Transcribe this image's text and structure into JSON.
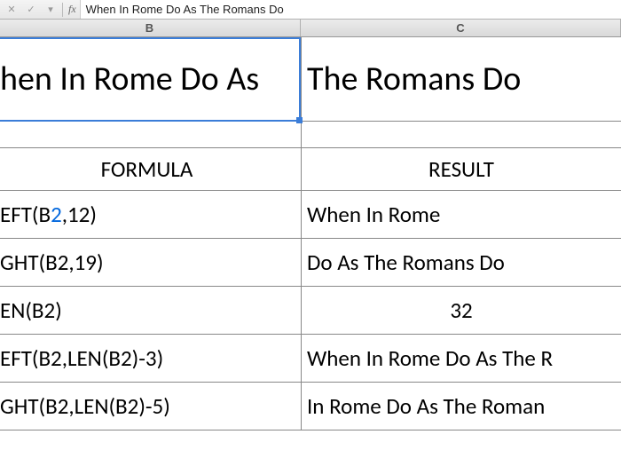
{
  "formula_bar": {
    "cancel_icon": "✕",
    "confirm_icon": "✓",
    "dropdown_icon": "▾",
    "fx_label": "fx",
    "value": "When In Rome Do As The Romans Do"
  },
  "columns": {
    "b": "B",
    "c": "C"
  },
  "big_cell": {
    "b_visible": "hen In Rome Do As",
    "c_visible": "The Romans Do"
  },
  "headers": {
    "formula": "FORMULA",
    "result": "RESULT"
  },
  "rows": [
    {
      "formula_pre": "EFT(B",
      "formula_hl": "2",
      "formula_post": ",12)",
      "result": "When In Rome",
      "result_center": false
    },
    {
      "formula_pre": "GHT(B2,19)",
      "formula_hl": "",
      "formula_post": "",
      "result": "Do As The Romans Do",
      "result_center": false
    },
    {
      "formula_pre": "EN(B2)",
      "formula_hl": "",
      "formula_post": "",
      "result": "32",
      "result_center": true
    },
    {
      "formula_pre": "EFT(B2,LEN(B2)-3)",
      "formula_hl": "",
      "formula_post": "",
      "result": "When In Rome Do As The R",
      "result_center": false
    },
    {
      "formula_pre": "GHT(B2,LEN(B2)-5)",
      "formula_hl": "",
      "formula_post": "",
      "result": "In Rome Do As The Roman",
      "result_center": false
    }
  ]
}
